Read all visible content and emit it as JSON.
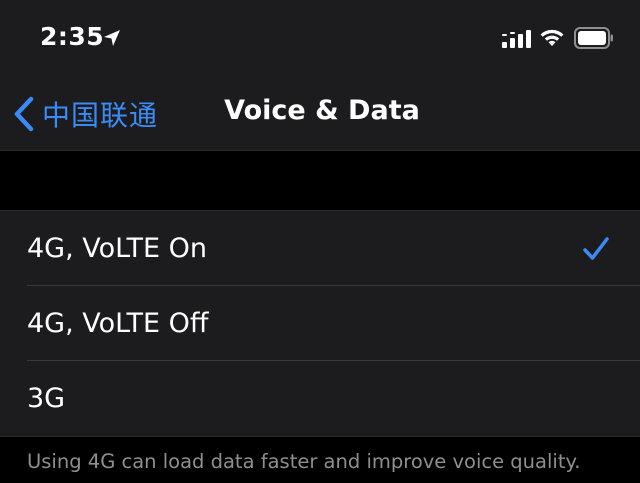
{
  "status_bar": {
    "time": "2:35",
    "icons": [
      "location-arrow-icon",
      "cellular-signal-icon",
      "wifi-icon",
      "battery-icon"
    ]
  },
  "nav": {
    "back_label": "中国联通",
    "title": "Voice & Data"
  },
  "options": [
    {
      "label": "4G, VoLTE On",
      "selected": true
    },
    {
      "label": "4G, VoLTE Off",
      "selected": false
    },
    {
      "label": "3G",
      "selected": false
    }
  ],
  "footer": "Using 4G can load data faster and improve voice quality.",
  "colors": {
    "accent": "#3b8bf7",
    "background": "#000000",
    "surface": "#1c1c1e",
    "secondary_text": "#8e8e93"
  }
}
